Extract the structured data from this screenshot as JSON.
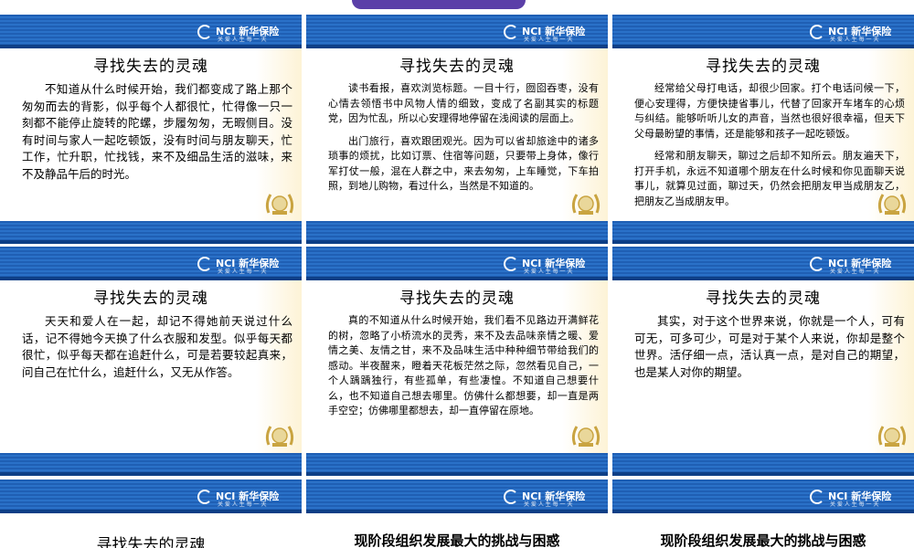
{
  "brand": {
    "logo_text": "NCI 新华保险",
    "logo_sub": "关 爱 人 生 每 一 天"
  },
  "slides": [
    {
      "title": "寻找失去的灵魂",
      "paragraphs": [
        "不知道从什么时候开始，我们都变成了路上那个匆匆而去的背影，似乎每个人都很忙，忙得像一只一刻都不能停止旋转的陀螺，步履匆匆，无暇侧目。没有时间与家人一起吃顿饭，没有时间与朋友聊天，忙工作，忙升职，忙找钱，来不及细品生活的滋味，来不及静品午后的时光。"
      ]
    },
    {
      "title": "寻找失去的灵魂",
      "paragraphs": [
        "读书看报，喜欢浏览标题。一目十行，囫囵吞枣，没有心情去领悟书中风物人情的细致，变成了名副其实的标题党，因为忙乱，所以心安理得地停留在浅阅读的层面上。",
        "出门旅行，喜欢跟团观光。因为可以省却旅途中的诸多琐事的烦扰，比如订票、住宿等问题，只要带上身体，像行军打仗一般，混在人群之中，来去匆匆，上车睡觉，下车拍照，到地儿购物，看过什么，当然是不知道的。"
      ]
    },
    {
      "title": "寻找失去的灵魂",
      "paragraphs": [
        "经常给父母打电话，却很少回家。打个电话问候一下，便心安理得，方便快捷省事儿，代替了回家开车堵车的心烦与纠结。能够听听儿女的声音，当然也很好很幸福，但天下父母最盼望的事情，还是能够和孩子一起吃顿饭。",
        "经常和朋友聊天，聊过之后却不知所云。朋友遍天下，打开手机，永远不知道哪个朋友在什么时候和你见面聊天说事儿，就算见过面，聊过天，仍然会把朋友甲当成朋友乙，把朋友乙当成朋友甲。"
      ]
    },
    {
      "title": "寻找失去的灵魂",
      "paragraphs": [
        "天天和爱人在一起，却记不得她前天说过什么话，记不得她今天换了什么衣服和发型。似乎每天都很忙，似乎每天都在追赶什么，可是若要较起真来，问自己在忙什么，追赶什么，又无从作答。"
      ]
    },
    {
      "title": "寻找失去的灵魂",
      "paragraphs": [
        "真的不知道从什么时候开始，我们看不见路边开满鲜花的树，忽略了小桥流水的灵秀，来不及去品味亲情之暖、爱情之美、友情之甘，来不及品味生活中种种细节带给我们的感动。半夜醒来，瞪着天花板茫然之际，忽然看见自己，一个人踽踽独行，有些孤单，有些凄惶。不知道自己想要什么，也不知道自己想去哪里。仿佛什么都想要，却一直是两手空空；仿佛哪里都想去，却一直停留在原地。"
      ]
    },
    {
      "title": "寻找失去的灵魂",
      "paragraphs": [
        "其实，对于这个世界来说，你就是一个人，可有可无，可多可少，可是对于某个人来说，你却是整个世界。活仔细一点，活认真一点，是对自己的期望，也是某人对你的期望。"
      ]
    }
  ],
  "partial_row": [
    "寻找失去的灵魂",
    "现阶段组织发展最大的挑战与困惑",
    "现阶段组织发展最大的挑战与困惑"
  ],
  "colors": {
    "band_blue": "#2a71c8",
    "band_dark": "#0d3f86",
    "cream": "#fdf3d6",
    "gold": "#c9a441"
  }
}
